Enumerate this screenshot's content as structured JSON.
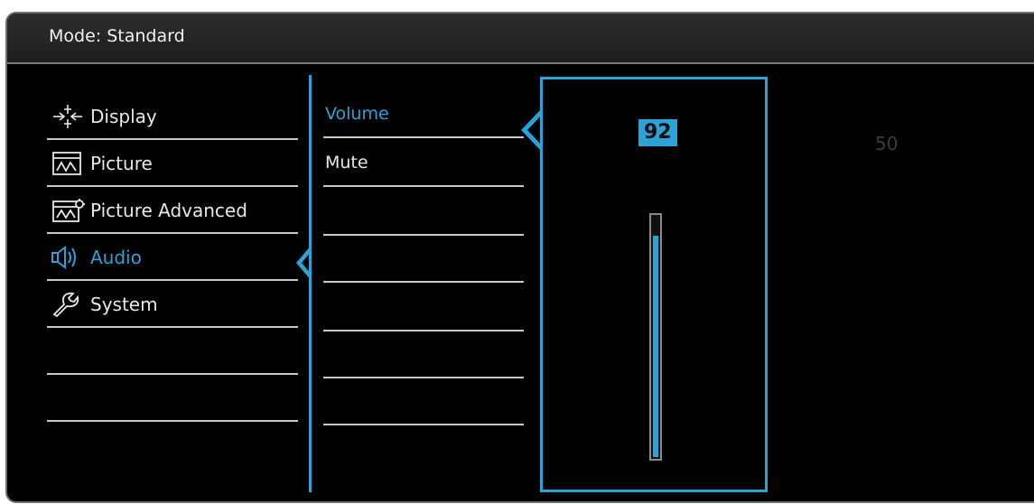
{
  "header": {
    "mode_label": "Mode: Standard"
  },
  "menu": {
    "items": [
      {
        "label": "Display",
        "icon": "display-icon",
        "active": false
      },
      {
        "label": "Picture",
        "icon": "picture-icon",
        "active": false
      },
      {
        "label": "Picture Advanced",
        "icon": "picture-advanced-icon",
        "active": false
      },
      {
        "label": "Audio",
        "icon": "speaker-icon",
        "active": true
      },
      {
        "label": "System",
        "icon": "wrench-icon",
        "active": false
      },
      {
        "label": "",
        "icon": "",
        "active": false
      },
      {
        "label": "",
        "icon": "",
        "active": false
      }
    ]
  },
  "submenu": {
    "items": [
      {
        "label": "Volume",
        "active": true
      },
      {
        "label": "Mute",
        "active": false
      },
      {
        "label": ""
      },
      {
        "label": ""
      },
      {
        "label": ""
      },
      {
        "label": ""
      },
      {
        "label": ""
      }
    ]
  },
  "volume": {
    "value": "92",
    "level": 0.92
  },
  "secondary_value": "50",
  "colors": {
    "accent": "#29a3d8",
    "background": "#000000",
    "divider": "#c9c9c9"
  }
}
